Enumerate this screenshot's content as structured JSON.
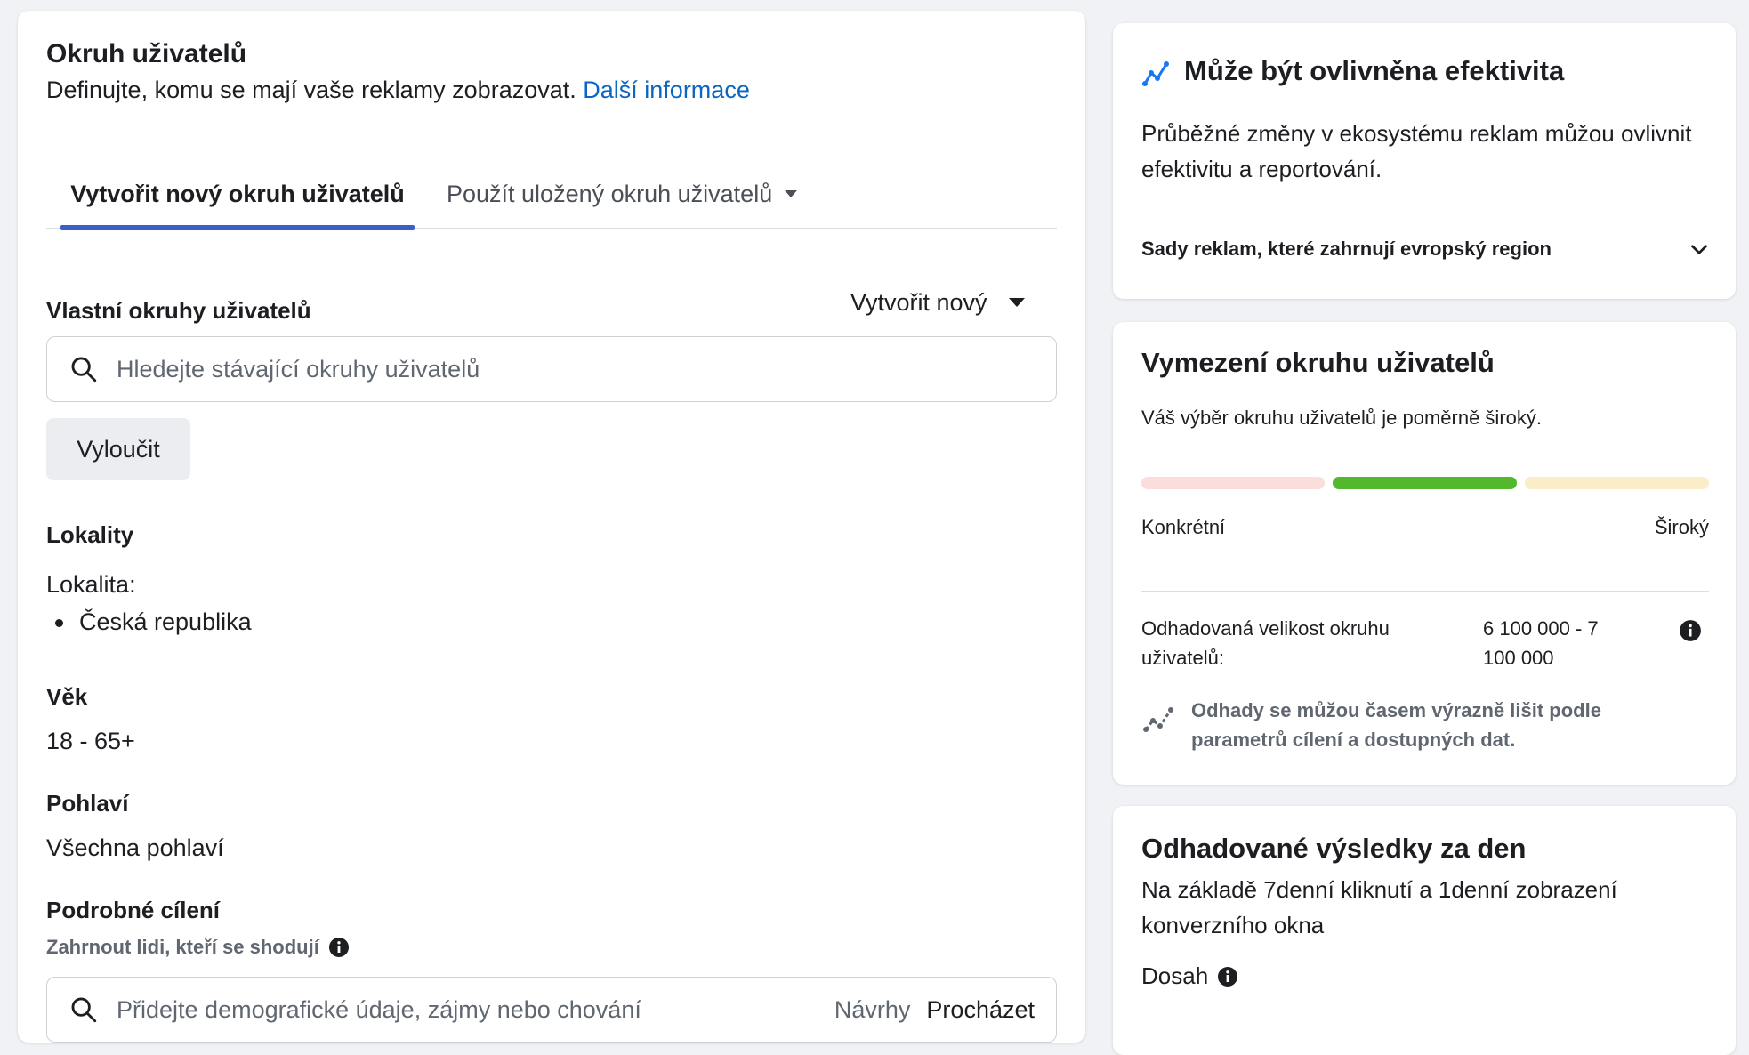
{
  "audience": {
    "title": "Okruh uživatelů",
    "description": "Definujte, komu se mají vaše reklamy zobrazovat.",
    "learn_more": "Další informace",
    "tabs": [
      {
        "label": "Vytvořit nový okruh uživatelů",
        "active": true
      },
      {
        "label": "Použít uložený okruh uživatelů",
        "active": false
      }
    ],
    "custom_label": "Vlastní okruhy uživatelů",
    "create_new": "Vytvořit nový",
    "search_placeholder": "Hledejte stávající okruhy uživatelů",
    "exclude_button": "Vyloučit",
    "locations": {
      "heading": "Lokality",
      "label": "Lokalita:",
      "items": [
        "Česká republika"
      ]
    },
    "age": {
      "heading": "Věk",
      "value": "18 - 65+"
    },
    "gender": {
      "heading": "Pohlaví",
      "value": "Všechna pohlaví"
    },
    "detailed": {
      "heading": "Podrobné cílení",
      "subheading": "Zahrnout lidi, kteří se shodují",
      "search_placeholder": "Přidejte demografické údaje, zájmy nebo chování",
      "suggestions": "Návrhy",
      "browse": "Procházet"
    }
  },
  "performance": {
    "title": "Může být ovlivněna efektivita",
    "text": "Průběžné změny v ekosystému reklam můžou ovlivnit efektivitu a reportování.",
    "region_label": "Sady reklam, které zahrnují evropský region"
  },
  "definition": {
    "title": "Vymezení okruhu uživatelů",
    "text": "Váš výběr okruhu uživatelů je poměrně široký.",
    "meter_left": "Konkrétní",
    "meter_right": "Široký",
    "meter_level": "middle",
    "size_label": "Odhadovaná velikost okruhu uživatelů:",
    "size_value": "6 100 000 - 7 100 000",
    "note": "Odhady se můžou časem výrazně lišit podle parametrů cílení a dostupných dat."
  },
  "daily": {
    "title": "Odhadované výsledky za den",
    "text": "Na základě 7denní kliknutí a 1denní zobrazení konverzního okna",
    "reach_label": "Dosah"
  },
  "colors": {
    "link": "#0a66c2",
    "tab_underline": "#3b5fc9",
    "meter_specific": "#fbdedb",
    "meter_mid": "#54b82c",
    "meter_broad": "#fbedc8",
    "perf_icon": "#1877f2"
  },
  "icons": {
    "search": "search-icon",
    "info": "info-icon",
    "chevron": "chevron-down-icon",
    "trend": "trend-icon",
    "estimate": "estimate-icon"
  }
}
